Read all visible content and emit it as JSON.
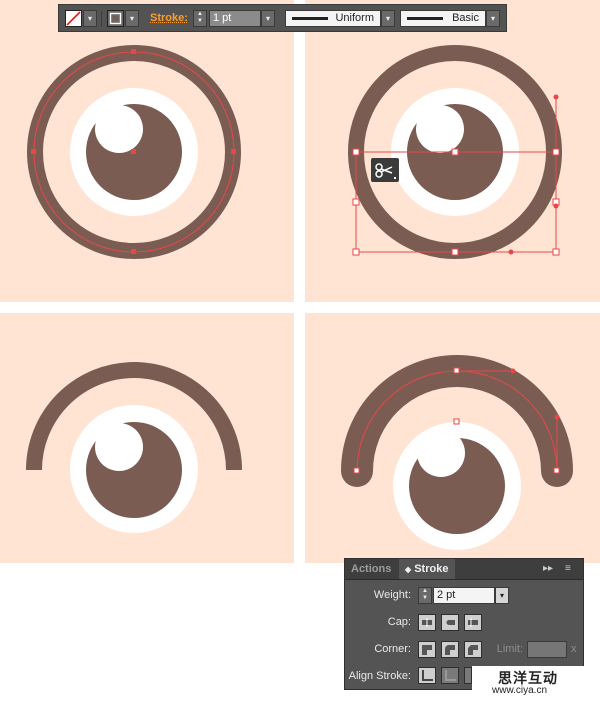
{
  "control_bar": {
    "stroke_label": "Stroke:",
    "weight_value": "1 pt",
    "profile_value": "Uniform",
    "brush_value": "Basic",
    "icons": [
      "no-fill-swatch-icon",
      "stroke-swatch-icon",
      "dropdown-arrow-icon",
      "stepper-icon"
    ]
  },
  "stroke_panel": {
    "tab_actions": "Actions",
    "tab_stroke": "Stroke",
    "weight_label": "Weight:",
    "weight_value": "2 pt",
    "cap_label": "Cap:",
    "corner_label": "Corner:",
    "limit_label": "Limit:",
    "limit_unit": "x",
    "align_label": "Align Stroke:"
  },
  "watermark": {
    "chinese": "思洋互动",
    "url": "www.ciya.cn"
  },
  "colors": {
    "canvas_background": "#ffe4d4",
    "eye_brown": "#7a5c52",
    "selection_red": "#e8474a",
    "panel_gray": "#545454",
    "stroke_label_orange": "#ff9d27"
  }
}
